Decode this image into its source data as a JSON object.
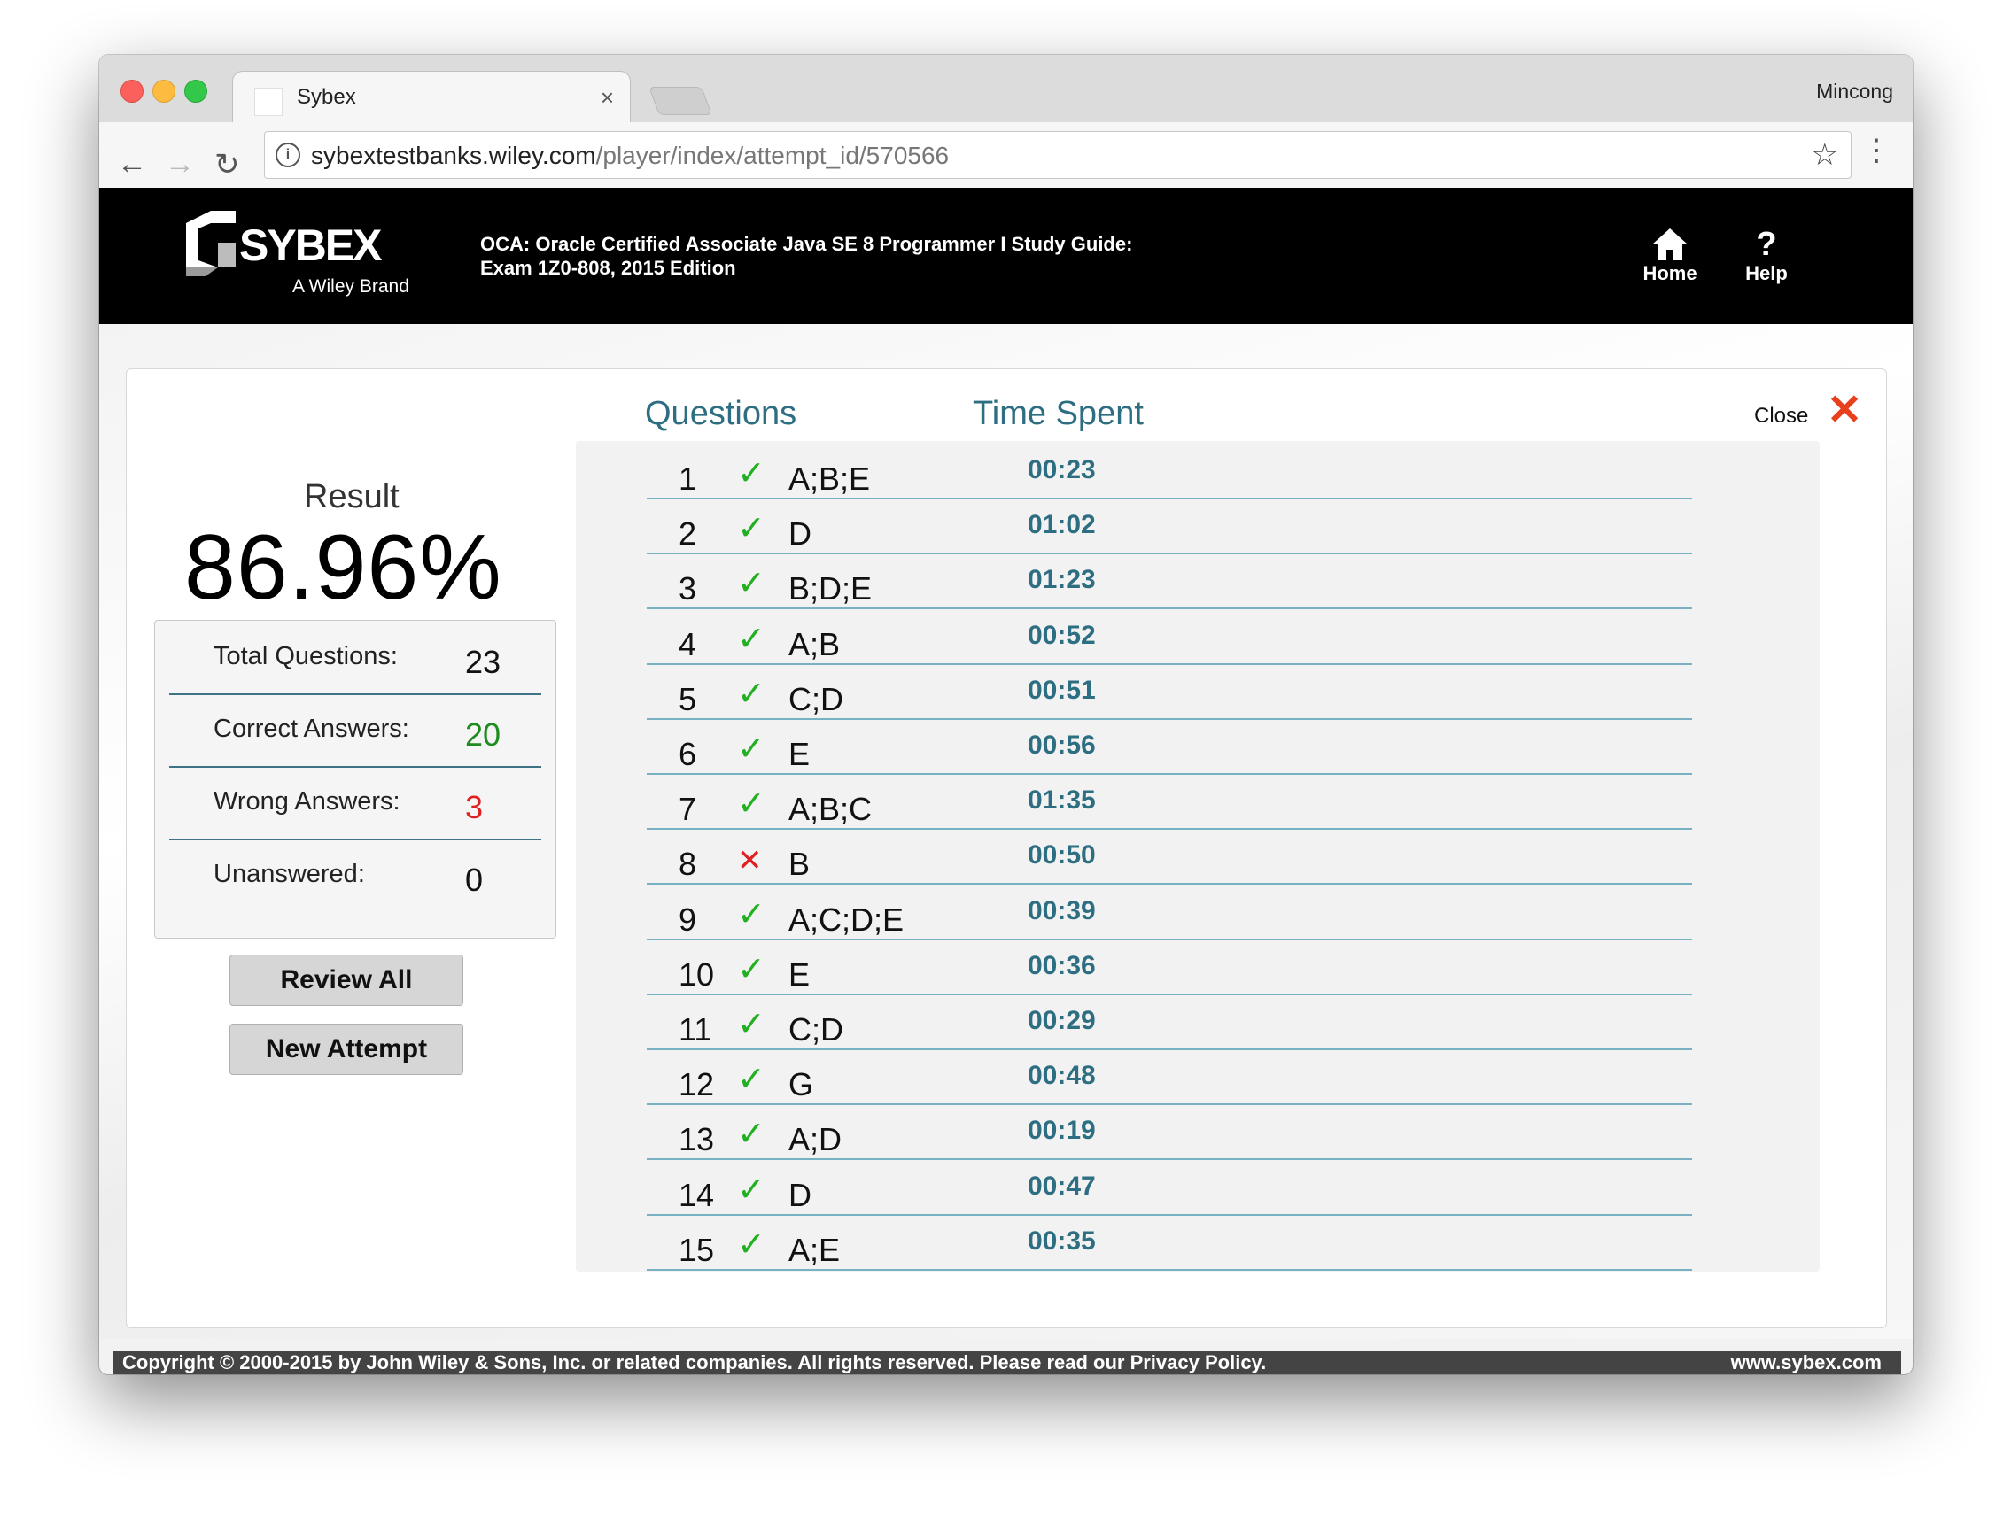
{
  "browser": {
    "tab_title": "Sybex",
    "profile_name": "Mincong",
    "url_domain": "sybextestbanks.wiley.com",
    "url_path": "/player/index/attempt_id/570566"
  },
  "header": {
    "logo_text": "SYBEX",
    "logo_subtext": "A Wiley Brand",
    "title_line1": "OCA: Oracle Certified Associate Java SE 8 Programmer I Study Guide:",
    "title_line2": "Exam 1Z0-808, 2015 Edition",
    "home_label": "Home",
    "help_label": "Help"
  },
  "results": {
    "close_label": "Close",
    "result_label": "Result",
    "score": "86.96%",
    "stats": [
      {
        "label": "Total Questions:",
        "value": "23"
      },
      {
        "label": "Correct Answers:",
        "value": "20"
      },
      {
        "label": "Wrong Answers:",
        "value": "3"
      },
      {
        "label": "Unanswered:",
        "value": "0"
      }
    ],
    "review_all_label": "Review All",
    "new_attempt_label": "New Attempt",
    "questions_header": "Questions",
    "time_header": "Time Spent",
    "questions": [
      {
        "num": "1",
        "correct": true,
        "answer": "A;B;E",
        "time": "00:23"
      },
      {
        "num": "2",
        "correct": true,
        "answer": "D",
        "time": "01:02"
      },
      {
        "num": "3",
        "correct": true,
        "answer": "B;D;E",
        "time": "01:23"
      },
      {
        "num": "4",
        "correct": true,
        "answer": "A;B",
        "time": "00:52"
      },
      {
        "num": "5",
        "correct": true,
        "answer": "C;D",
        "time": "00:51"
      },
      {
        "num": "6",
        "correct": true,
        "answer": "E",
        "time": "00:56"
      },
      {
        "num": "7",
        "correct": true,
        "answer": "A;B;C",
        "time": "01:35"
      },
      {
        "num": "8",
        "correct": false,
        "answer": "B",
        "time": "00:50"
      },
      {
        "num": "9",
        "correct": true,
        "answer": "A;C;D;E",
        "time": "00:39"
      },
      {
        "num": "10",
        "correct": true,
        "answer": "E",
        "time": "00:36"
      },
      {
        "num": "11",
        "correct": true,
        "answer": "C;D",
        "time": "00:29"
      },
      {
        "num": "12",
        "correct": true,
        "answer": "G",
        "time": "00:48"
      },
      {
        "num": "13",
        "correct": true,
        "answer": "A;D",
        "time": "00:19"
      },
      {
        "num": "14",
        "correct": true,
        "answer": "D",
        "time": "00:47"
      },
      {
        "num": "15",
        "correct": true,
        "answer": "A;E",
        "time": "00:35"
      }
    ]
  },
  "footer": {
    "copyright": "Copyright © 2000-2015 by John Wiley & Sons, Inc. or related companies. All rights reserved. Please read our Privacy Policy.",
    "site": "www.sybex.com"
  },
  "colors": {
    "accent": "#2e6e82",
    "correct": "#22b022",
    "wrong": "#e02020",
    "close_x": "#e8401c"
  },
  "icons": {
    "check": "check-icon",
    "cross": "cross-icon",
    "home": "home-icon",
    "help": "help-icon",
    "close": "close-icon",
    "star": "star-icon"
  }
}
